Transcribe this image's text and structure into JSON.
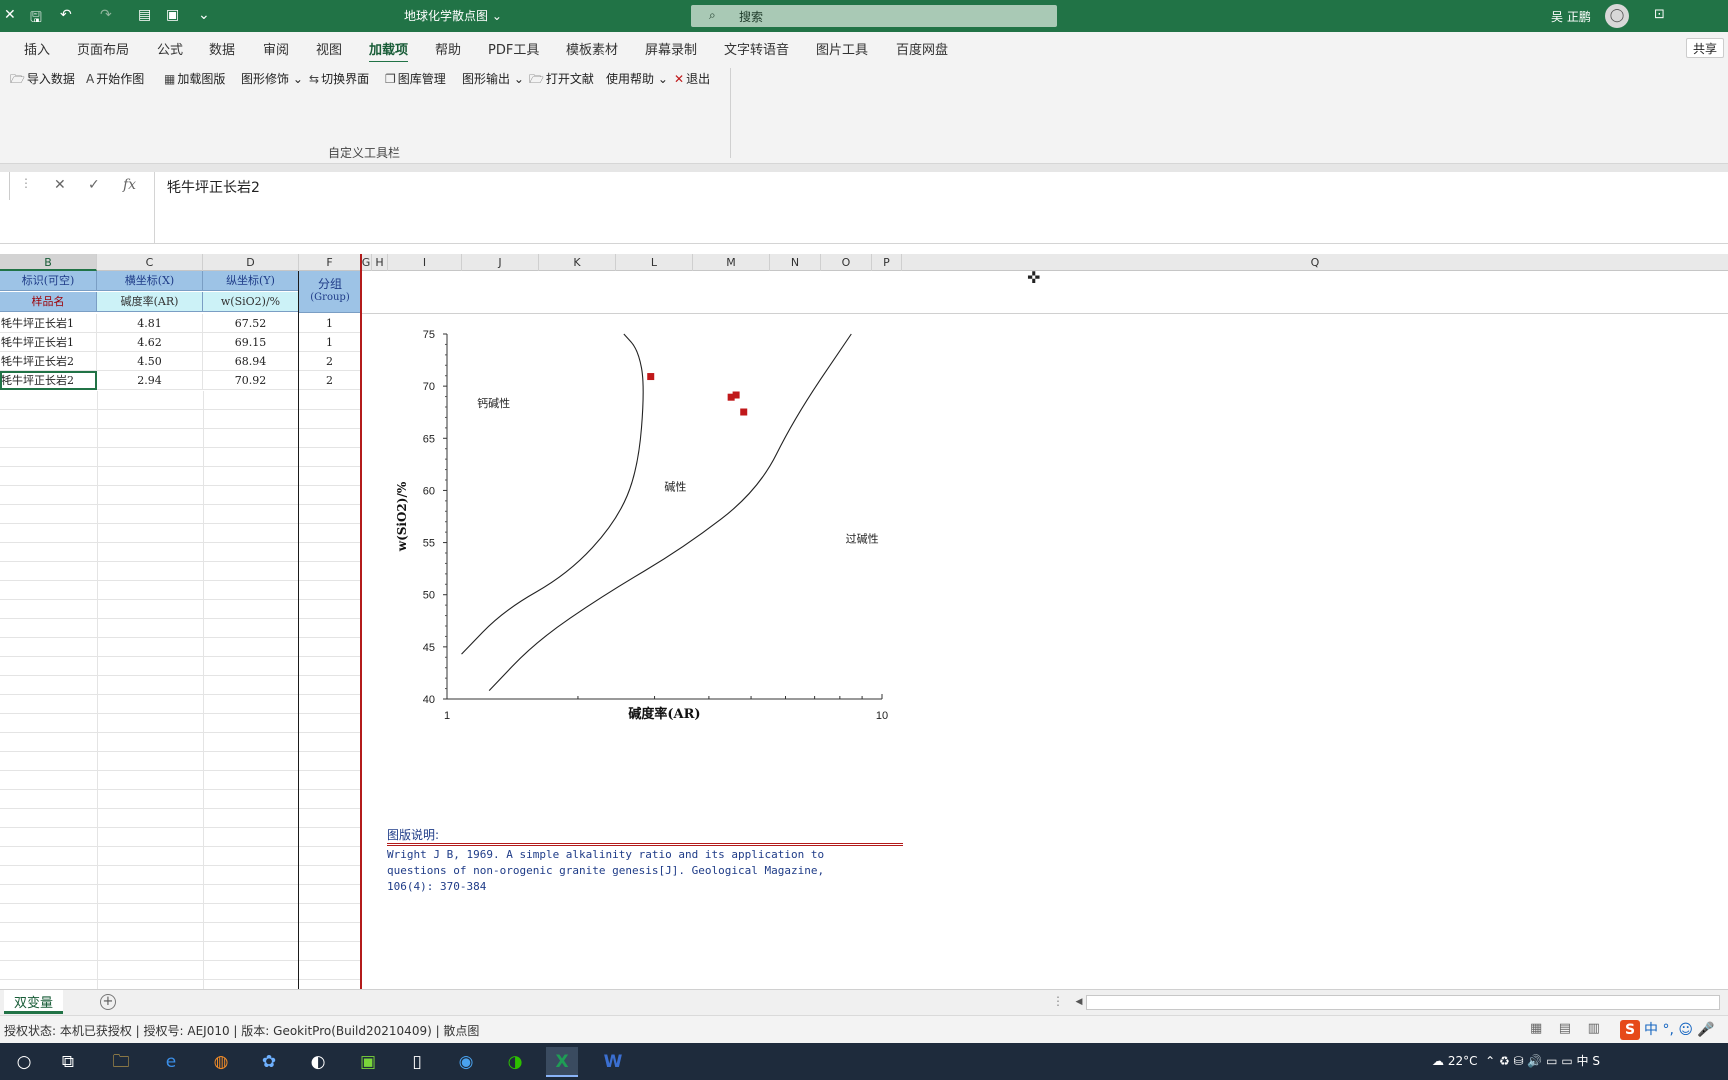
{
  "titlebar": {
    "doc_title": "地球化学散点图 ⌄",
    "search_placeholder": "搜索",
    "user_name": "吴 正鹏"
  },
  "ribbon": {
    "tabs": [
      "插入",
      "页面布局",
      "公式",
      "数据",
      "审阅",
      "视图",
      "加载项",
      "帮助",
      "PDF工具",
      "模板素材",
      "屏幕录制",
      "文字转语音",
      "图片工具",
      "百度网盘"
    ],
    "active_tab": "加载项",
    "share_label": "共享"
  },
  "toolbar": {
    "buttons": [
      "导入数据",
      "开始作图",
      "加载图版",
      "图形修饰 ⌄",
      "切换界面",
      "图库管理",
      "图形输出 ⌄",
      "打开文献",
      "使用帮助 ⌄",
      "退出"
    ],
    "group_label": "自定义工具栏"
  },
  "formula": {
    "value": "牦牛坪正长岩2"
  },
  "columns": [
    "B",
    "C",
    "D",
    "F",
    "G",
    "H",
    "I",
    "J",
    "K",
    "L",
    "M",
    "N",
    "O",
    "P",
    "Q"
  ],
  "table": {
    "header1": [
      "标识(可空)",
      "横坐标(X)",
      "纵坐标(Y)"
    ],
    "header2": [
      "样品名",
      "碱度率(AR)",
      "w(SiO2)/%"
    ],
    "group_header": [
      "分组",
      "(Group)"
    ],
    "rows": [
      {
        "name": "牦牛坪正长岩1",
        "x": "4.81",
        "y": "67.52",
        "group": "1"
      },
      {
        "name": "牦牛坪正长岩1",
        "x": "4.62",
        "y": "69.15",
        "group": "1"
      },
      {
        "name": "牦牛坪正长岩2",
        "x": "4.50",
        "y": "68.94",
        "group": "2"
      },
      {
        "name": "牦牛坪正长岩2",
        "x": "2.94",
        "y": "70.92",
        "group": "2"
      }
    ]
  },
  "chart_data": {
    "type": "scatter",
    "xlabel": "碱度率(AR)",
    "ylabel": "w(SiO2)/%",
    "x_scale": "log",
    "xlim": [
      1,
      10
    ],
    "ylim": [
      40,
      75
    ],
    "x_tick_labels": [
      "1",
      "10"
    ],
    "y_ticks": [
      40,
      45,
      50,
      55,
      60,
      65,
      70,
      75
    ],
    "points": [
      {
        "x": 4.81,
        "y": 67.52
      },
      {
        "x": 4.62,
        "y": 69.15
      },
      {
        "x": 4.5,
        "y": 68.94
      },
      {
        "x": 2.94,
        "y": 70.92
      }
    ],
    "point_color": "#c0181a",
    "boundaries": [
      {
        "name": "calc-alkaline/alkaline",
        "x": [
          1.08,
          1.35,
          1.9,
          2.45,
          2.75,
          2.85,
          2.75,
          2.55
        ],
        "y": [
          44.3,
          48.5,
          52,
          57,
          62,
          70,
          73.5,
          75
        ]
      },
      {
        "name": "alkaline/peralkaline",
        "x": [
          1.25,
          1.6,
          2.3,
          3.5,
          5.2,
          6.3,
          8.5
        ],
        "y": [
          40.8,
          45.5,
          50,
          54.5,
          60,
          67,
          75
        ]
      }
    ],
    "field_labels": [
      {
        "text": "钙碱性",
        "x": 1.28,
        "y": 68
      },
      {
        "text": "碱性",
        "x": 3.35,
        "y": 60
      },
      {
        "text": "过碱性",
        "x": 9.0,
        "y": 55
      }
    ]
  },
  "caption": {
    "title": "图版说明:",
    "text": "Wright J B, 1969. A simple alkalinity ratio and its application to\nquestions of non-orogenic granite genesis[J]. Geological Magazine,\n106(4): 370-384"
  },
  "sheet": {
    "tab_label": "双变量"
  },
  "status": {
    "text": "授权状态:  本机已获授权 |  授权号:  AEJ010 |  版本:  GeokitPro(Build20210409) | 散点图"
  },
  "tray": {
    "temperature": "22°C",
    "ime": "中"
  }
}
